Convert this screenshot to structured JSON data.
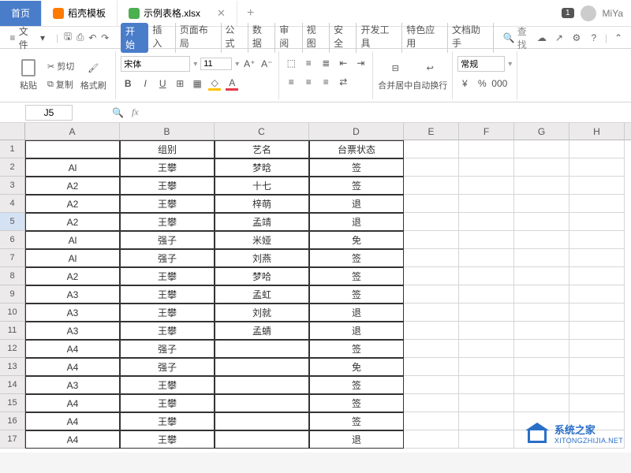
{
  "titlebar": {
    "home_tab": "首页",
    "template_tab": "稻壳模板",
    "file_tab": "示例表格.xlsx",
    "notif_count": "1",
    "username": "MiYa"
  },
  "menubar": {
    "file": "文件",
    "tabs": [
      "开始",
      "插入",
      "页面布局",
      "公式",
      "数据",
      "审阅",
      "视图",
      "安全",
      "开发工具",
      "特色应用",
      "文档助手"
    ],
    "search": "查找"
  },
  "ribbon": {
    "paste": "粘贴",
    "cut": "剪切",
    "copy": "复制",
    "format_paint": "格式刷",
    "font_name": "宋体",
    "font_size": "11",
    "merge": "合并居中",
    "wrap": "自动换行",
    "normal": "常规"
  },
  "namebox": "J5",
  "col_letters": [
    "A",
    "B",
    "C",
    "D",
    "E",
    "F",
    "G",
    "H"
  ],
  "headers": [
    "",
    "组别",
    "艺名",
    "台票状态"
  ],
  "rows": [
    {
      "n": 1,
      "a": "",
      "b": "组别",
      "c": "艺名",
      "d": "台票状态"
    },
    {
      "n": 2,
      "a": "Al",
      "b": "王攀",
      "c": "梦晗",
      "d": "签"
    },
    {
      "n": 3,
      "a": "A2",
      "b": "王攀",
      "c": "十七",
      "d": "签"
    },
    {
      "n": 4,
      "a": "A2",
      "b": "王攀",
      "c": "梓萌",
      "d": "退"
    },
    {
      "n": 5,
      "a": "A2",
      "b": "王攀",
      "c": "孟靖",
      "d": "退"
    },
    {
      "n": 6,
      "a": "Al",
      "b": "强子",
      "c": "米娅",
      "d": "免"
    },
    {
      "n": 7,
      "a": "Al",
      "b": "强子",
      "c": "刘燕",
      "d": "签"
    },
    {
      "n": 8,
      "a": "A2",
      "b": "王攀",
      "c": "梦哈",
      "d": "签"
    },
    {
      "n": 9,
      "a": "A3",
      "b": "王攀",
      "c": "孟虹",
      "d": "签"
    },
    {
      "n": 10,
      "a": "A3",
      "b": "王攀",
      "c": "刘就",
      "d": "退"
    },
    {
      "n": 11,
      "a": "A3",
      "b": "王攀",
      "c": "孟蜻",
      "d": "退"
    },
    {
      "n": 12,
      "a": "A4",
      "b": "强子",
      "c": "",
      "d": "签"
    },
    {
      "n": 13,
      "a": "A4",
      "b": "强子",
      "c": "",
      "d": "免"
    },
    {
      "n": 14,
      "a": "A3",
      "b": "王攀",
      "c": "",
      "d": "签"
    },
    {
      "n": 15,
      "a": "A4",
      "b": "王攀",
      "c": "",
      "d": "签"
    },
    {
      "n": 16,
      "a": "A4",
      "b": "王攀",
      "c": "",
      "d": "签"
    },
    {
      "n": 17,
      "a": "A4",
      "b": "王攀",
      "c": "",
      "d": "退"
    }
  ],
  "watermark": {
    "title": "系统之家",
    "sub": "XITONGZHIJIA.NET"
  }
}
